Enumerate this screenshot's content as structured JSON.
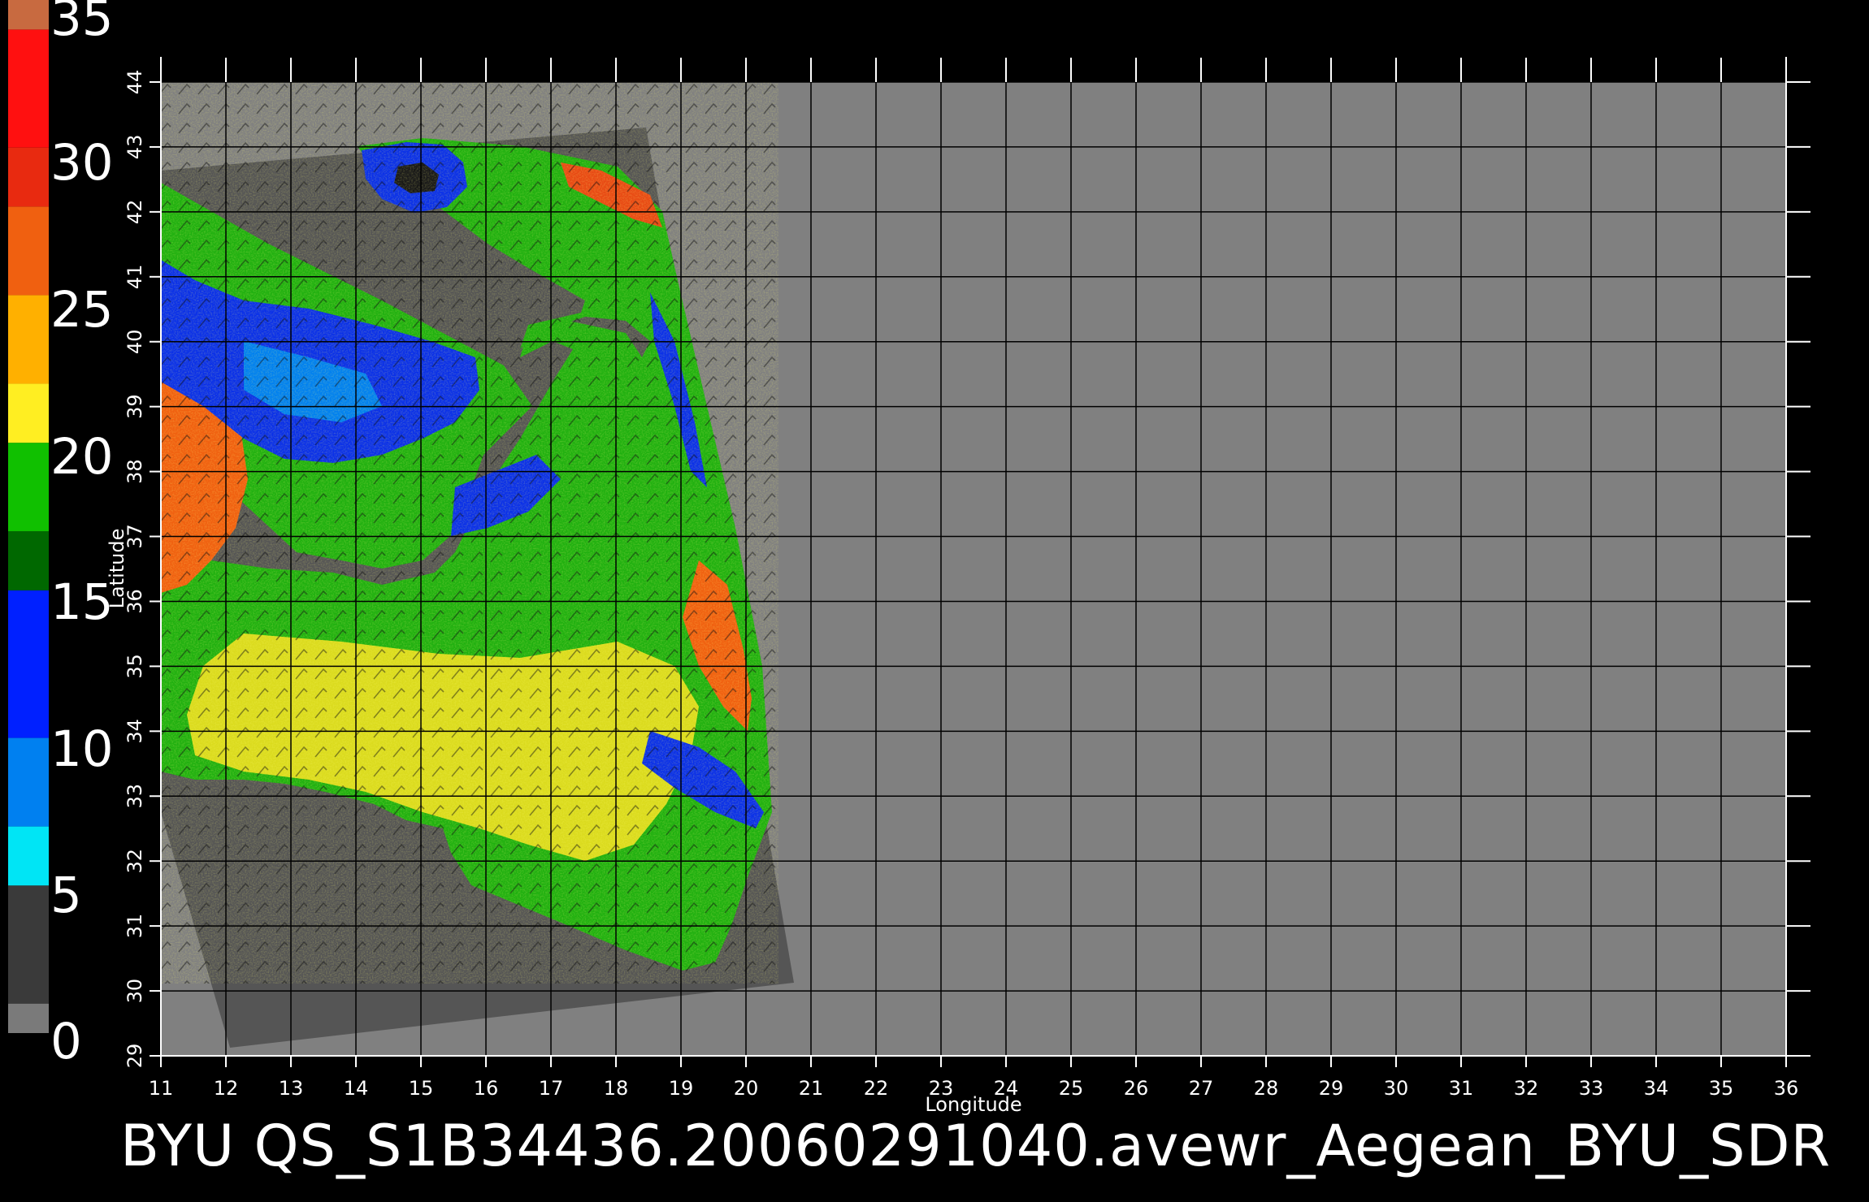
{
  "colorbar": {
    "labels": [
      "35",
      "30",
      "25",
      "20",
      "15",
      "10",
      "5",
      "0"
    ],
    "segments": [
      {
        "from": 0,
        "to": 1,
        "color": "#7a7a7a"
      },
      {
        "from": 1,
        "to": 5,
        "color": "#3a3a3a"
      },
      {
        "from": 5,
        "to": 7,
        "color": "#00e5f5"
      },
      {
        "from": 7,
        "to": 10,
        "color": "#0080f0"
      },
      {
        "from": 10,
        "to": 15,
        "color": "#0020ff"
      },
      {
        "from": 15,
        "to": 17,
        "color": "#006800"
      },
      {
        "from": 17,
        "to": 20,
        "color": "#10c000"
      },
      {
        "from": 20,
        "to": 22,
        "color": "#ffee22"
      },
      {
        "from": 22,
        "to": 25,
        "color": "#ffb000"
      },
      {
        "from": 25,
        "to": 28,
        "color": "#f06010"
      },
      {
        "from": 28,
        "to": 30,
        "color": "#e82a10"
      },
      {
        "from": 30,
        "to": 34,
        "color": "#ff1010"
      },
      {
        "from": 34,
        "to": 35,
        "color": "#c86a40"
      }
    ]
  },
  "map": {
    "x_axis": {
      "label": "Longitude",
      "ticks": [
        "11",
        "12",
        "13",
        "14",
        "15",
        "16",
        "17",
        "18",
        "19",
        "20",
        "21",
        "22",
        "23",
        "24",
        "25",
        "26",
        "27",
        "28",
        "29",
        "30",
        "31",
        "32",
        "33",
        "34",
        "35",
        "36"
      ]
    },
    "y_axis": {
      "label": "Latitude",
      "ticks": [
        "29",
        "30",
        "31",
        "32",
        "33",
        "34",
        "35",
        "36",
        "37",
        "38",
        "39",
        "40",
        "41",
        "42",
        "43",
        "44"
      ]
    },
    "colors": {
      "background": "#808080",
      "swath": "#555555",
      "grid": "#000000"
    }
  },
  "footer": {
    "title": "BYU  QS_S1B34436.20060291040.avewr_Aegean_BYU_SDR"
  }
}
